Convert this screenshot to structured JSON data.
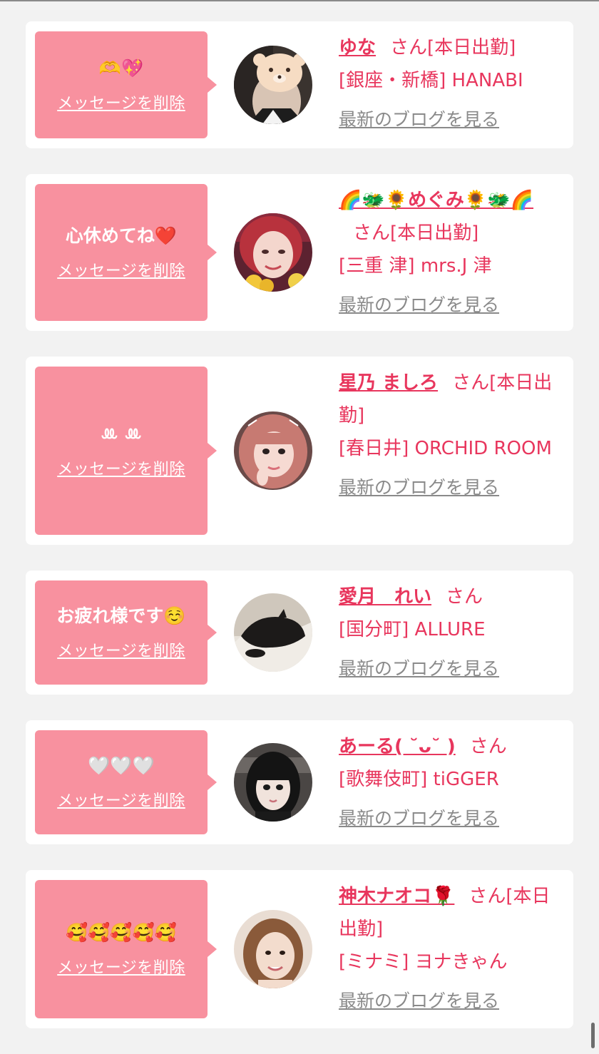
{
  "theme": {
    "accent": "#e8365d",
    "bubble": "#f8919f",
    "background": "#f2f2f2",
    "link_gray": "#8a8a8a"
  },
  "delete_label": "メッセージを削除",
  "blog_label": "最新のブログを見る",
  "messages": [
    {
      "message": "🫶💖",
      "name": "ゆな",
      "suffix": "さん[本日出勤]",
      "shop": "[銀座・新橋] HANABI",
      "avatar_icon": "avatar-photo-bear-sticker-icon"
    },
    {
      "message": "心休めてね❤️",
      "name": "🌈🐲🌻めぐみ🌻🐲🌈",
      "suffix": "さん[本日出勤]",
      "shop": "[三重 津] mrs.J 津",
      "avatar_icon": "avatar-photo-red-hair-icon"
    },
    {
      "message": "ꔛ ꔛ",
      "name": "星乃 ましろ",
      "suffix": "さん[本日出勤]",
      "shop": "[春日井] ORCHID ROOM",
      "avatar_icon": "avatar-photo-pink-hair-icon"
    },
    {
      "message": "お疲れ様です☺️",
      "name": "愛月　れい",
      "suffix": "さん",
      "shop": "[国分町] ALLURE",
      "avatar_icon": "avatar-photo-black-cat-icon"
    },
    {
      "message": "🤍🤍🤍",
      "name": "あーる( ˘ᴗ˘ )",
      "suffix": "さん",
      "shop": "[歌舞伎町] tiGGER",
      "avatar_icon": "avatar-photo-black-hair-icon"
    },
    {
      "message": "🥰🥰🥰🥰🥰",
      "name": "神木ナオコ🌹",
      "suffix": "さん[本日出勤]",
      "shop": "[ミナミ] ヨナきゃん",
      "avatar_icon": "avatar-photo-brown-hair-icon"
    }
  ]
}
